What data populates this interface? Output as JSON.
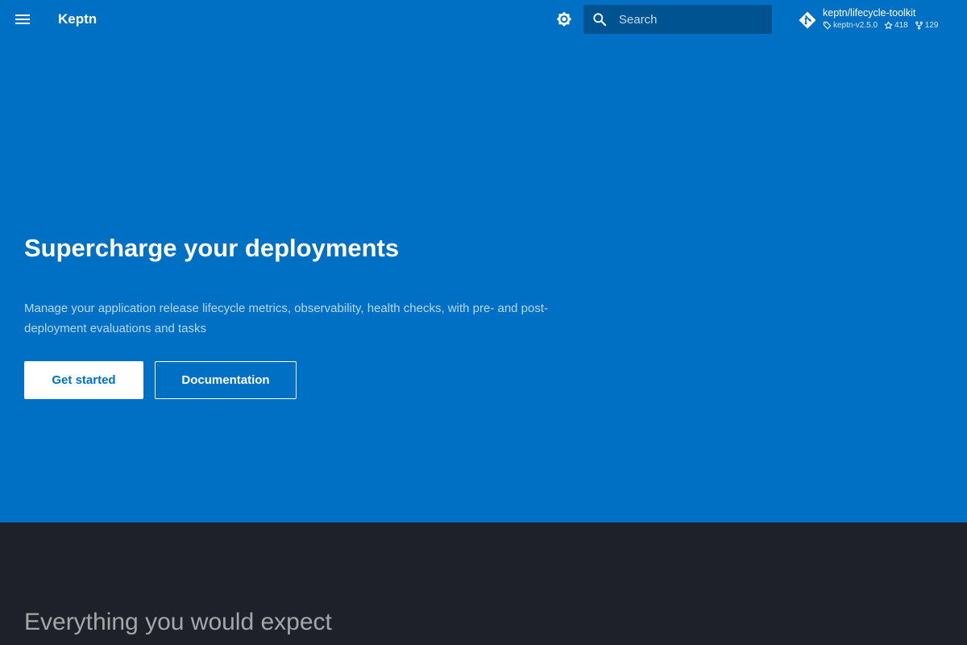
{
  "header": {
    "title": "Keptn",
    "menu_icon": "menu-icon",
    "theme_icon": "brightness-icon",
    "search": {
      "placeholder": "Search",
      "icon": "search-icon"
    },
    "repo": {
      "icon": "git-icon",
      "name": "keptn/lifecycle-toolkit",
      "version": "keptn-v2.5.0",
      "stars": "418",
      "forks": "129"
    }
  },
  "hero": {
    "title": "Supercharge your deployments",
    "description": "Manage your application release lifecycle metrics, observability, health checks, with pre- and post-deployment evaluations and tasks",
    "primary_button": "Get started",
    "secondary_button": "Documentation"
  },
  "features": {
    "title": "Everything you would expect"
  },
  "colors": {
    "primary": "#0070c4",
    "background_dark": "#1e2129",
    "text_light": "#ffffff"
  }
}
